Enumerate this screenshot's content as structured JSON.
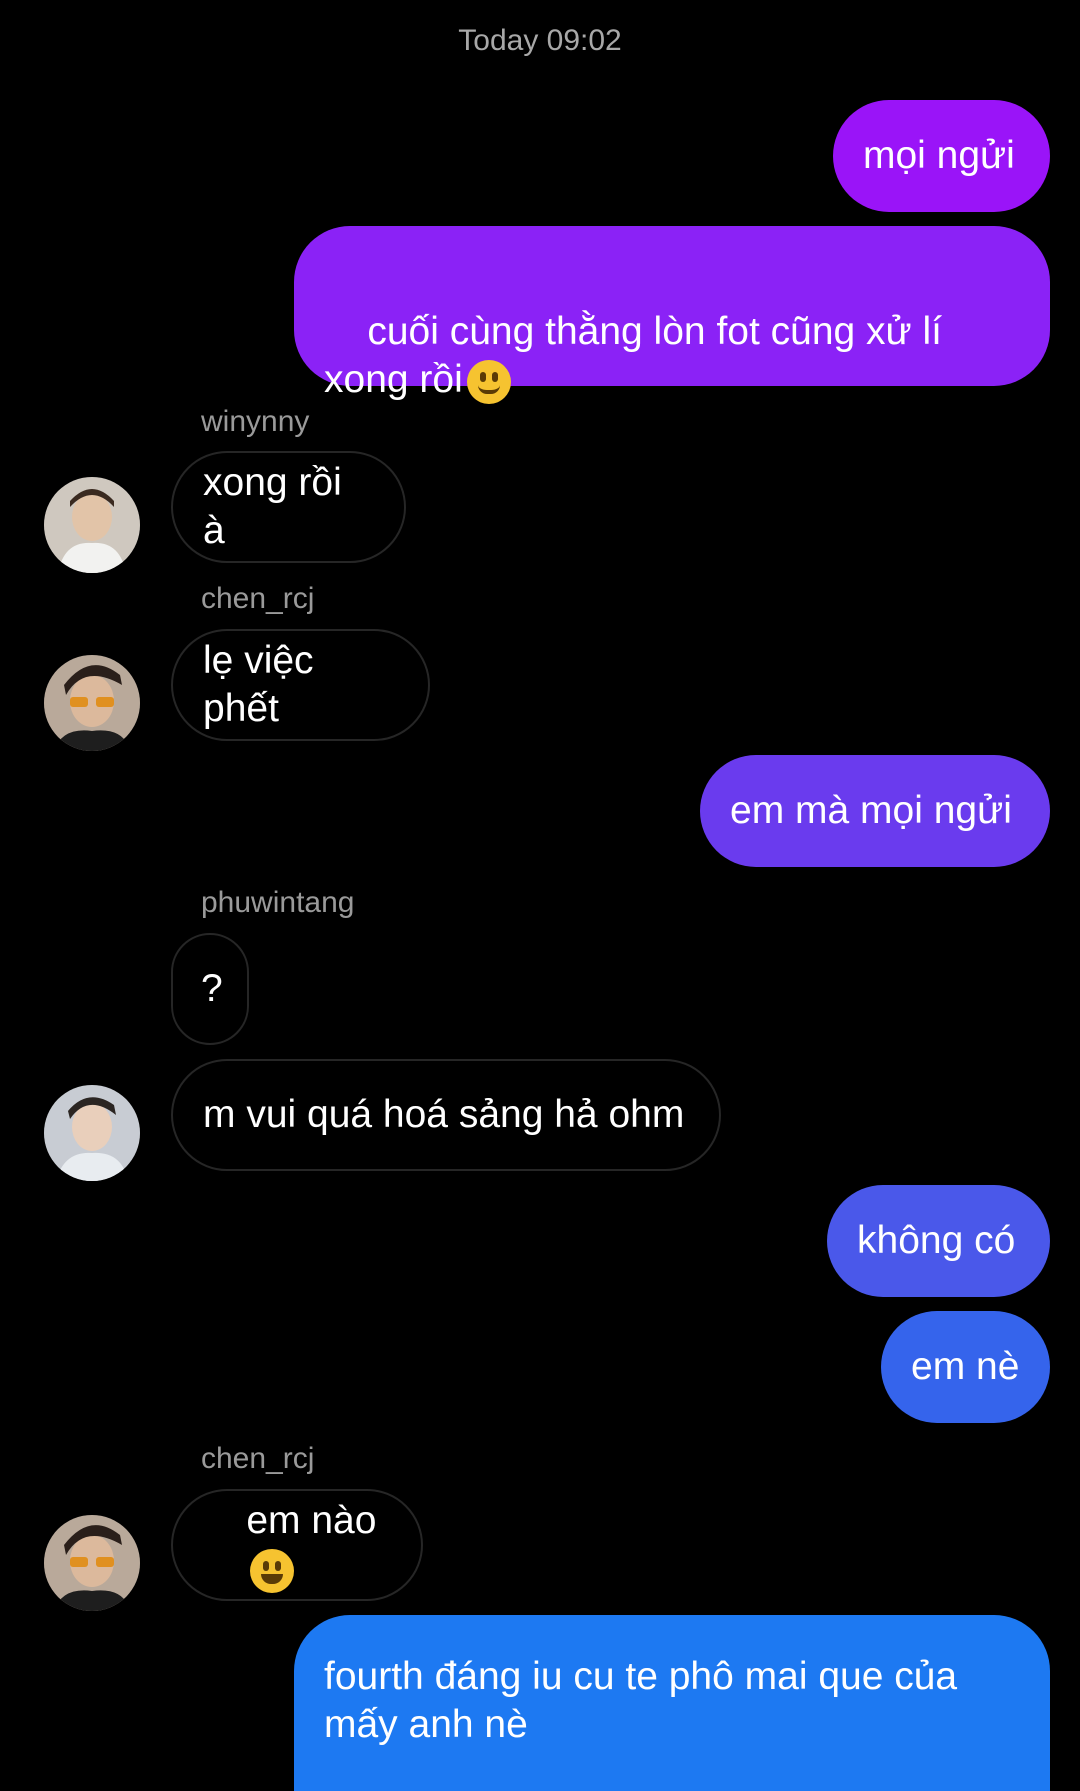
{
  "timestamp": "Today 09:02",
  "colors": {
    "background": "#000000",
    "incoming_border": "#262626",
    "sender": "#9a9a9a"
  },
  "messages": [
    {
      "direction": "out",
      "text": "mọi ngửi"
    },
    {
      "direction": "out",
      "text": "cuối cùng thằng lòn fot cũng xử lí xong rồi",
      "emoji": "slightly-smiling-face"
    },
    {
      "direction": "in",
      "sender": "winynny",
      "text": "xong rồi à"
    },
    {
      "direction": "in",
      "sender": "chen_rcj",
      "text": "lẹ việc phết"
    },
    {
      "direction": "out",
      "text": "em mà mọi ngửi"
    },
    {
      "direction": "in",
      "sender": "phuwintang",
      "text": "?"
    },
    {
      "direction": "in",
      "text": "m vui quá hoá sảng hả ohm"
    },
    {
      "direction": "out",
      "text": "không có"
    },
    {
      "direction": "out",
      "text": "em nè"
    },
    {
      "direction": "in",
      "sender": "chen_rcj",
      "text": "em nào",
      "emoji": "grinning-face"
    },
    {
      "direction": "out",
      "text": "fourth đáng iu cu te phô mai que của mấy anh nè"
    }
  ]
}
